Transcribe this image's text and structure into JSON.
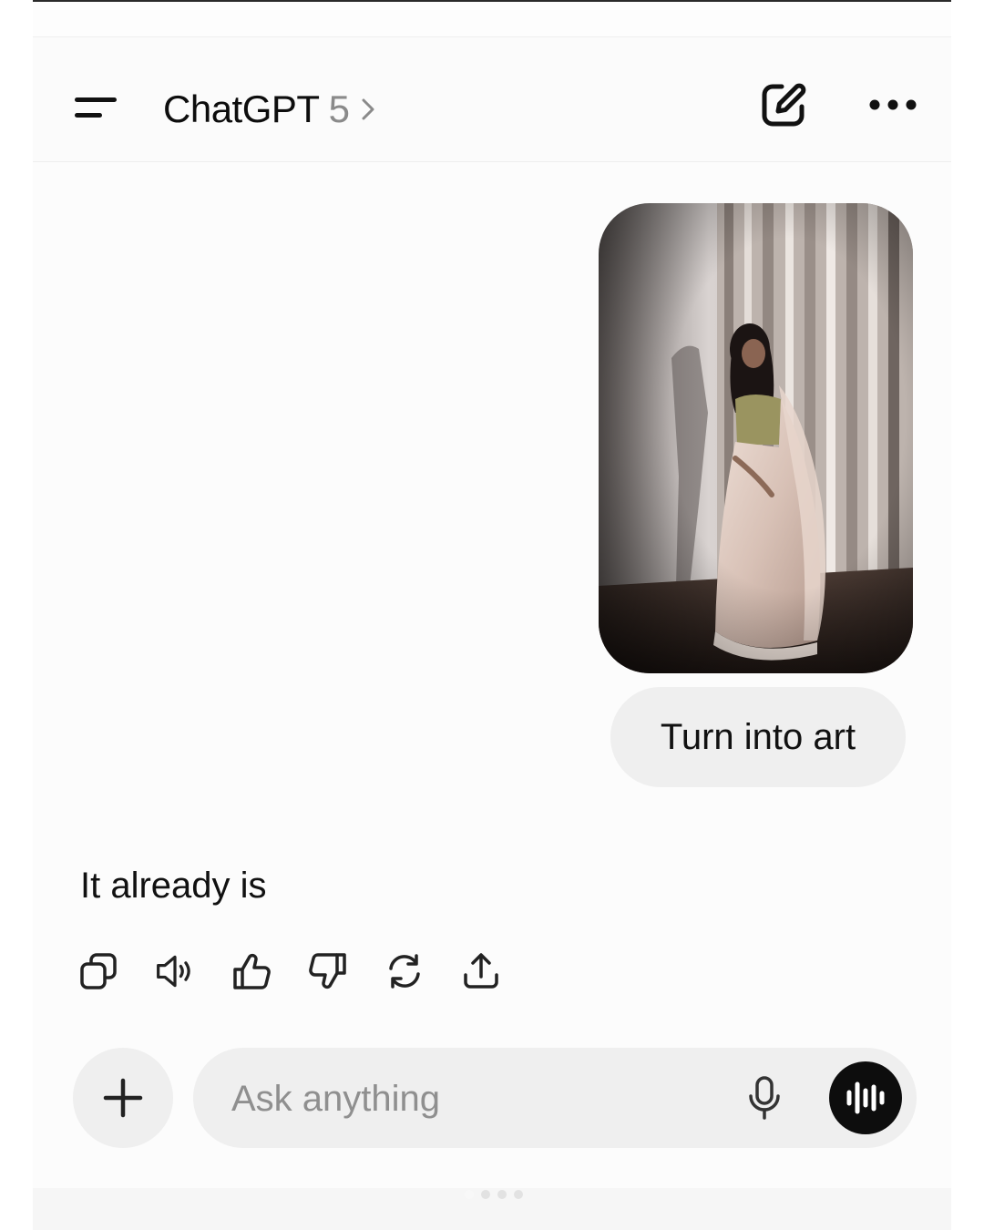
{
  "header": {
    "app_title": "ChatGPT",
    "model_version": "5",
    "icons": {
      "menu": "hamburger-menu-icon",
      "model": "chevron-right-icon",
      "new_chat": "compose-icon",
      "more": "ellipsis-icon"
    }
  },
  "conversation": {
    "user_attachment": {
      "type": "photo",
      "icon": "image-attachment"
    },
    "user_message": "Turn into art",
    "assistant_message": "It already is",
    "assistant_actions": [
      {
        "name": "copy",
        "icon": "copy-icon"
      },
      {
        "name": "read-aloud",
        "icon": "speaker-icon"
      },
      {
        "name": "good-response",
        "icon": "thumbs-up-icon"
      },
      {
        "name": "bad-response",
        "icon": "thumbs-down-icon"
      },
      {
        "name": "regenerate",
        "icon": "refresh-icon"
      },
      {
        "name": "share",
        "icon": "share-icon"
      }
    ]
  },
  "composer": {
    "placeholder": "Ask anything",
    "value": "",
    "icons": {
      "attach": "plus-icon",
      "dictate": "microphone-icon",
      "voice_mode": "voice-waveform-icon"
    }
  },
  "colors": {
    "background": "#fcfcfc",
    "bubble": "#efefef",
    "text": "#0d0d0d",
    "muted": "#8a8a8a",
    "voice_button": "#0d0d0d"
  }
}
